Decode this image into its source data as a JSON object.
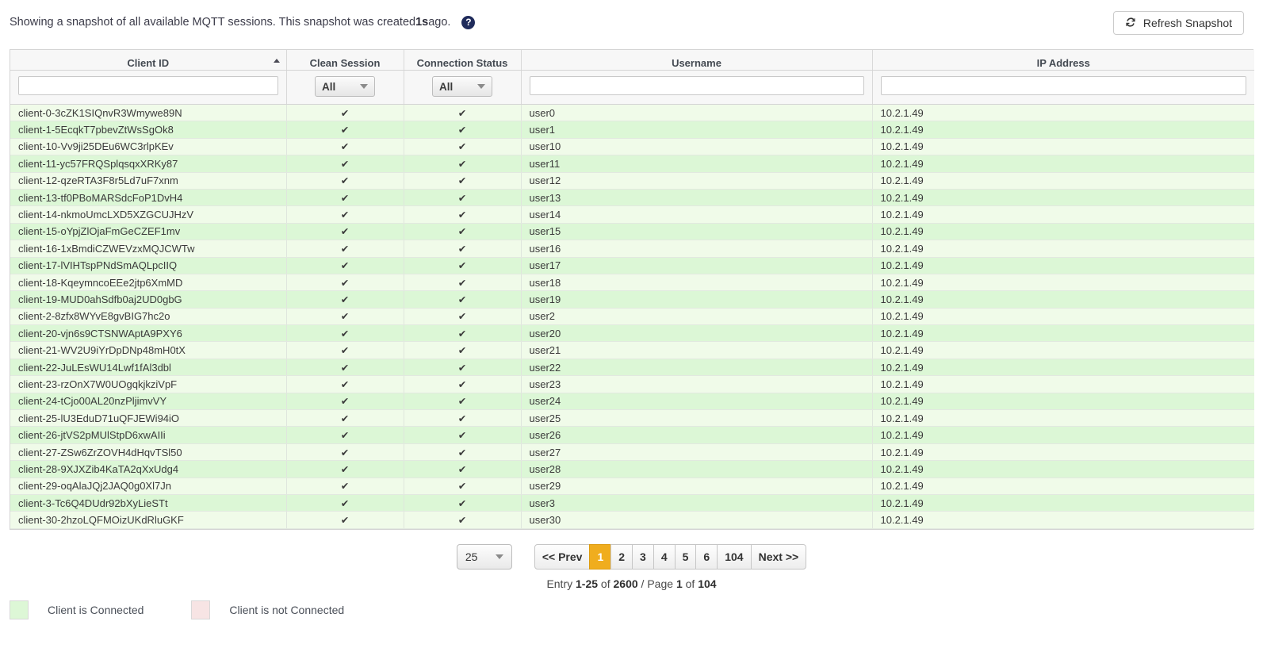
{
  "header": {
    "snapshot_text_before": "Showing a snapshot of all available MQTT sessions. This snapshot was created ",
    "snapshot_age": "1s",
    "snapshot_text_after": " ago.",
    "help_icon_glyph": "?",
    "help_icon_name": "question-mark-circle-icon",
    "refresh_label": "Refresh Snapshot",
    "refresh_icon_glyph": "↻",
    "refresh_icon_name": "refresh-icon"
  },
  "table": {
    "columns": [
      {
        "label": "Client ID",
        "filter_type": "text",
        "value": "",
        "sorted": "asc"
      },
      {
        "label": "Clean Session",
        "filter_type": "select",
        "value": "All"
      },
      {
        "label": "Connection Status",
        "filter_type": "select",
        "value": "All"
      },
      {
        "label": "Username",
        "filter_type": "text",
        "value": ""
      },
      {
        "label": "IP Address",
        "filter_type": "text",
        "value": ""
      }
    ],
    "filter_options": [
      "All"
    ],
    "check_glyph": "✔",
    "rows": [
      {
        "client_id": "client-0-3cZK1SIQnvR3Wmywe89N",
        "clean_session": true,
        "connection_status": true,
        "username": "user0",
        "ip": "10.2.1.49"
      },
      {
        "client_id": "client-1-5EcqkT7pbevZtWsSgOk8",
        "clean_session": true,
        "connection_status": true,
        "username": "user1",
        "ip": "10.2.1.49"
      },
      {
        "client_id": "client-10-Vv9ji25DEu6WC3rlpKEv",
        "clean_session": true,
        "connection_status": true,
        "username": "user10",
        "ip": "10.2.1.49"
      },
      {
        "client_id": "client-11-yc57FRQSplqsqxXRKy87",
        "clean_session": true,
        "connection_status": true,
        "username": "user11",
        "ip": "10.2.1.49"
      },
      {
        "client_id": "client-12-qzeRTA3F8r5Ld7uF7xnm",
        "clean_session": true,
        "connection_status": true,
        "username": "user12",
        "ip": "10.2.1.49"
      },
      {
        "client_id": "client-13-tf0PBoMARSdcFoP1DvH4",
        "clean_session": true,
        "connection_status": true,
        "username": "user13",
        "ip": "10.2.1.49"
      },
      {
        "client_id": "client-14-nkmoUmcLXD5XZGCUJHzV",
        "clean_session": true,
        "connection_status": true,
        "username": "user14",
        "ip": "10.2.1.49"
      },
      {
        "client_id": "client-15-oYpjZlOjaFmGeCZEF1mv",
        "clean_session": true,
        "connection_status": true,
        "username": "user15",
        "ip": "10.2.1.49"
      },
      {
        "client_id": "client-16-1xBmdiCZWEVzxMQJCWTw",
        "clean_session": true,
        "connection_status": true,
        "username": "user16",
        "ip": "10.2.1.49"
      },
      {
        "client_id": "client-17-lVIHTspPNdSmAQLpcIIQ",
        "clean_session": true,
        "connection_status": true,
        "username": "user17",
        "ip": "10.2.1.49"
      },
      {
        "client_id": "client-18-KqeymncoEEe2jtp6XmMD",
        "clean_session": true,
        "connection_status": true,
        "username": "user18",
        "ip": "10.2.1.49"
      },
      {
        "client_id": "client-19-MUD0ahSdfb0aj2UD0gbG",
        "clean_session": true,
        "connection_status": true,
        "username": "user19",
        "ip": "10.2.1.49"
      },
      {
        "client_id": "client-2-8zfx8WYvE8gvBIG7hc2o",
        "clean_session": true,
        "connection_status": true,
        "username": "user2",
        "ip": "10.2.1.49"
      },
      {
        "client_id": "client-20-vjn6s9CTSNWAptA9PXY6",
        "clean_session": true,
        "connection_status": true,
        "username": "user20",
        "ip": "10.2.1.49"
      },
      {
        "client_id": "client-21-WV2U9iYrDpDNp48mH0tX",
        "clean_session": true,
        "connection_status": true,
        "username": "user21",
        "ip": "10.2.1.49"
      },
      {
        "client_id": "client-22-JuLEsWU14Lwf1fAl3dbl",
        "clean_session": true,
        "connection_status": true,
        "username": "user22",
        "ip": "10.2.1.49"
      },
      {
        "client_id": "client-23-rzOnX7W0UOgqkjkziVpF",
        "clean_session": true,
        "connection_status": true,
        "username": "user23",
        "ip": "10.2.1.49"
      },
      {
        "client_id": "client-24-tCjo00AL20nzPljimvVY",
        "clean_session": true,
        "connection_status": true,
        "username": "user24",
        "ip": "10.2.1.49"
      },
      {
        "client_id": "client-25-lU3EduD71uQFJEWi94iO",
        "clean_session": true,
        "connection_status": true,
        "username": "user25",
        "ip": "10.2.1.49"
      },
      {
        "client_id": "client-26-jtVS2pMUlStpD6xwAIIi",
        "clean_session": true,
        "connection_status": true,
        "username": "user26",
        "ip": "10.2.1.49"
      },
      {
        "client_id": "client-27-ZSw6ZrZOVH4dHqvTSl50",
        "clean_session": true,
        "connection_status": true,
        "username": "user27",
        "ip": "10.2.1.49"
      },
      {
        "client_id": "client-28-9XJXZib4KaTA2qXxUdg4",
        "clean_session": true,
        "connection_status": true,
        "username": "user28",
        "ip": "10.2.1.49"
      },
      {
        "client_id": "client-29-oqAlaJQj2JAQ0g0Xl7Jn",
        "clean_session": true,
        "connection_status": true,
        "username": "user29",
        "ip": "10.2.1.49"
      },
      {
        "client_id": "client-3-Tc6Q4DUdr92bXyLieSTt",
        "clean_session": true,
        "connection_status": true,
        "username": "user3",
        "ip": "10.2.1.49"
      },
      {
        "client_id": "client-30-2hzoLQFMOizUKdRluGKF",
        "clean_session": true,
        "connection_status": true,
        "username": "user30",
        "ip": "10.2.1.49"
      }
    ]
  },
  "pagination": {
    "page_size": "25",
    "prev_label": "<< Prev",
    "next_label": "Next >>",
    "pages": [
      "1",
      "2",
      "3",
      "4",
      "5",
      "6",
      "104"
    ],
    "active_page": "1",
    "entry_prefix": "Entry ",
    "entry_range": "1-25",
    "entry_of": " of ",
    "entry_total": "2600",
    "entry_sep": " / Page ",
    "current_page": "1",
    "page_of": " of ",
    "total_pages": "104"
  },
  "legend": {
    "items": [
      {
        "label": "Client is Connected",
        "color": "#ddf7d6"
      },
      {
        "label": "Client is not Connected",
        "color": "#f7e4e4"
      }
    ]
  }
}
